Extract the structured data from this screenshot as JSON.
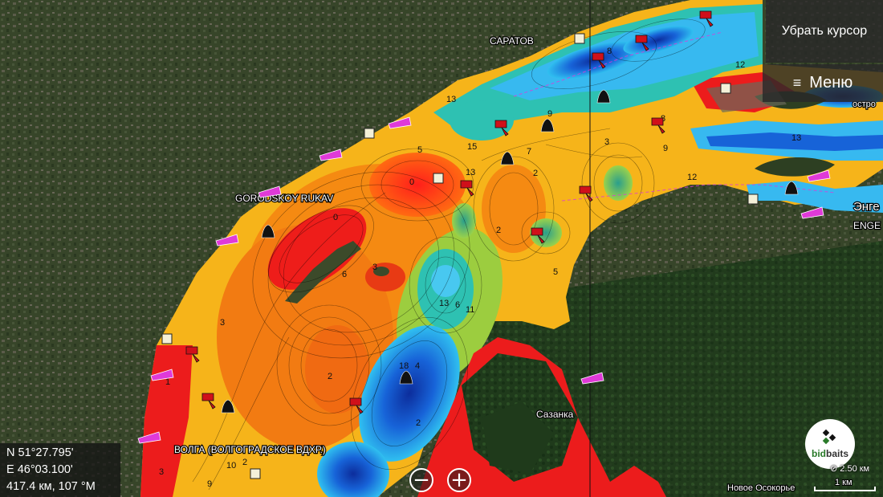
{
  "map": {
    "labels": {
      "saratov": "САРАТОВ",
      "gorodskoy": "GORODSKOY RUKAV",
      "volga": "ВОЛГА (ВОЛГОГРАДСКОЕ ВДХР.)",
      "sazanka": "Сазанка",
      "engels_ru": "Энге",
      "engels_en": "ENGE",
      "ostrov": "остро",
      "novoe_osokorye": "Новое Осокорье"
    },
    "depth_labels": [
      "13",
      "15",
      "5",
      "7",
      "9",
      "3",
      "0",
      "0",
      "6",
      "3",
      "2",
      "5",
      "12",
      "13",
      "6",
      "11",
      "18",
      "4",
      "2",
      "10",
      "9",
      "12",
      "13",
      "8",
      "8",
      "2",
      "3",
      "13",
      "9",
      "2",
      "3",
      "2",
      "1"
    ],
    "colors": {
      "shallow": "#e8251d",
      "mid_orange": "#f58a12",
      "yellow": "#f5c814",
      "green": "#8ec63f",
      "teal": "#2ec3b8",
      "cyan": "#2fb8f0",
      "blue": "#1560d8",
      "deep": "#0b2a9a",
      "land": "#3a4a2c",
      "marker_red": "#d0101a",
      "marker_black": "#111111",
      "marker_magenta": "#e03ad8"
    }
  },
  "ui": {
    "clear_cursor": "Убрать курсор",
    "menu": "Меню",
    "menu_icon": "≡",
    "zoom_out": "−",
    "zoom_in": "+",
    "coords": {
      "lat": "N  51°27.795'",
      "lon": "E  46°03.100'",
      "dist": "417.4 км, 107 °М"
    },
    "logo": {
      "name_a": "bid",
      "name_b": "baits"
    },
    "scale": {
      "zoom": "2.50 км",
      "bar": "1 км"
    }
  }
}
